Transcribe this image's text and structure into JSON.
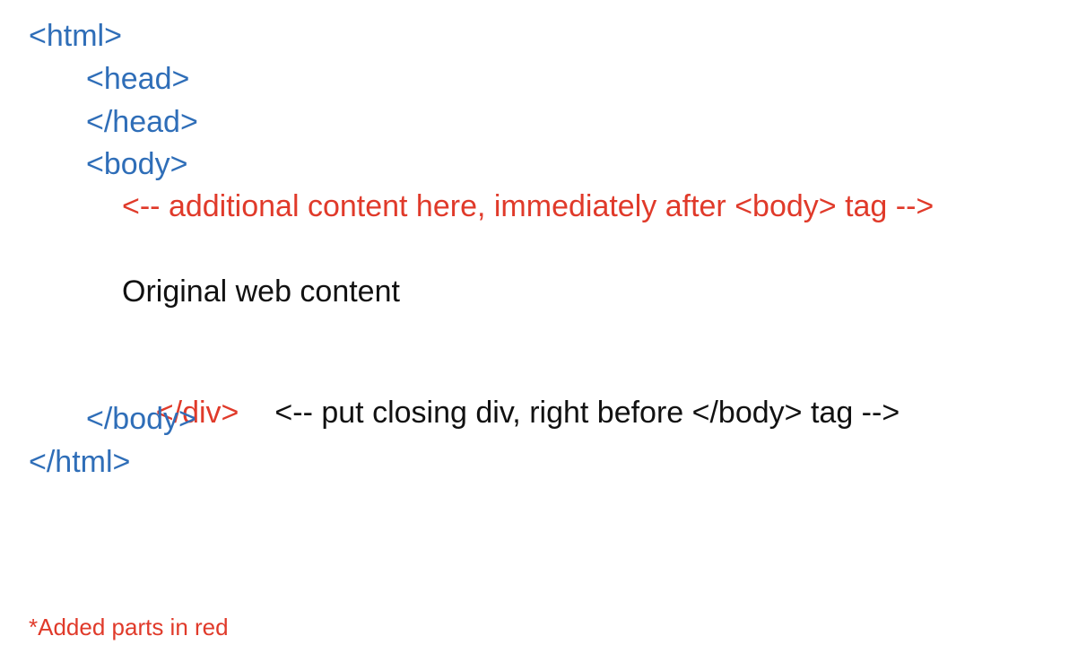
{
  "lines": {
    "html_open": "<html>",
    "head_open": "<head>",
    "head_close": "</head>",
    "body_open": "<body>",
    "additional_content_comment": "<-- additional content here, immediately after <body> tag -->",
    "original_content": "Original web content",
    "div_close": "</div>",
    "closing_div_comment": "<-- put closing div, right before </body> tag -->",
    "body_close": "</body>",
    "html_close": "</html>"
  },
  "note": "*Added parts in red",
  "colors": {
    "tag_blue": "#2f6eb8",
    "added_red": "#e03a2a",
    "text_black": "#111111"
  }
}
